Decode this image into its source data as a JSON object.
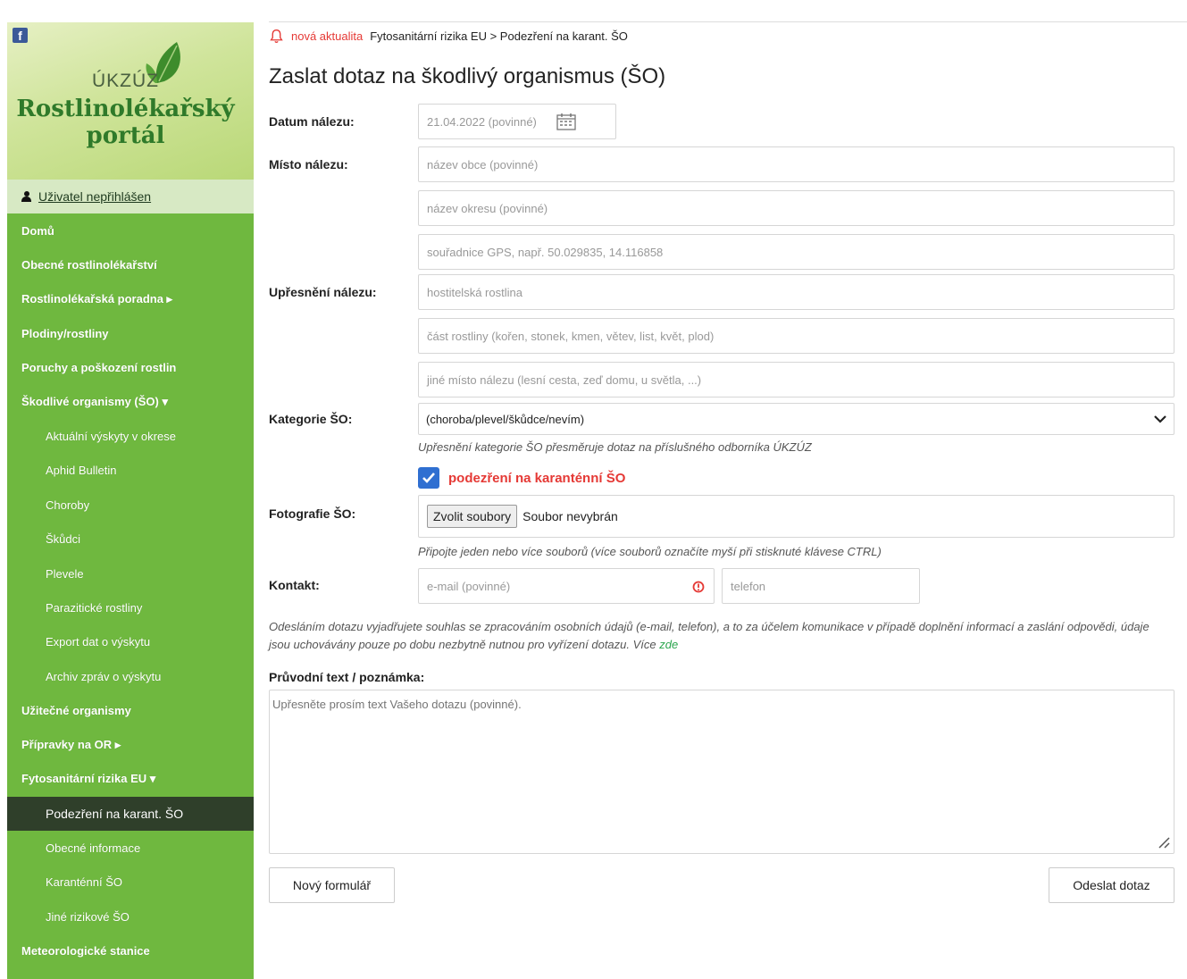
{
  "sidebar": {
    "brand_short": "ÚKZÚZ",
    "brand_title": "Rostlinolékařský portál",
    "user": "Uživatel nepřihlášen",
    "nav": [
      {
        "label": "Domů",
        "level": 1
      },
      {
        "label": "Obecné rostlinolékařství",
        "level": 1
      },
      {
        "label": "Rostlinolékařská poradna ▸",
        "level": 1
      },
      {
        "label": "Plodiny/rostliny",
        "level": 1
      },
      {
        "label": "Poruchy a poškození rostlin",
        "level": 1
      },
      {
        "label": "Škodlivé organismy (ŠO) ▾",
        "level": 1
      },
      {
        "label": "Aktuální výskyty v okrese",
        "level": 2
      },
      {
        "label": "Aphid Bulletin",
        "level": 2
      },
      {
        "label": "Choroby",
        "level": 2
      },
      {
        "label": "Škůdci",
        "level": 2
      },
      {
        "label": "Plevele",
        "level": 2
      },
      {
        "label": "Parazitické rostliny",
        "level": 2
      },
      {
        "label": "Export dat o výskytu",
        "level": 2
      },
      {
        "label": "Archiv zpráv o výskytu",
        "level": 2
      },
      {
        "label": "Užitečné organismy",
        "level": 1
      },
      {
        "label": "Přípravky na OR ▸",
        "level": 1
      },
      {
        "label": "Fytosanitární rizika EU ▾",
        "level": 1
      },
      {
        "label": "Podezření na karant. ŠO",
        "level": 2,
        "active": true
      },
      {
        "label": "Obecné informace",
        "level": 2
      },
      {
        "label": "Karanténní ŠO",
        "level": 2
      },
      {
        "label": "Jiné rizikové ŠO",
        "level": 2
      },
      {
        "label": "Meteorologické stanice",
        "level": 1
      }
    ]
  },
  "breadcrumb": {
    "new_news": "nová aktualita",
    "path": "Fytosanitární rizika EU > Podezření na karant. ŠO"
  },
  "page_title": "Zaslat dotaz na škodlivý organismus (ŠO)",
  "form": {
    "date_label": "Datum nálezu:",
    "date_value": "21.04.2022 (povinné)",
    "place_label": "Místo nálezu:",
    "place_placeholders": [
      "název obce (povinné)",
      "název okresu (povinné)",
      "souřadnice GPS, např. 50.029835, 14.116858"
    ],
    "detail_label": "Upřesnění nálezu:",
    "detail_placeholders": [
      "hostitelská rostlina",
      "část rostliny (kořen, stonek, kmen, větev, list, květ, plod)",
      "jiné místo nálezu (lesní cesta, zeď domu, u světla, ...)"
    ],
    "category_label": "Kategorie ŠO:",
    "category_value": "(choroba/plevel/škůdce/nevím)",
    "category_hint": "Upřesnění kategorie ŠO přesměruje dotaz na příslušného odborníka ÚKZÚZ",
    "quarantine_checked": true,
    "quarantine_label": "podezření na karanténní ŠO",
    "photo_label": "Fotografie ŠO:",
    "file_button": "Zvolit soubory",
    "file_status": "Soubor nevybrán",
    "photo_hint": "Připojte jeden nebo více souborů (více souborů označíte myší při stisknuté klávese CTRL)",
    "contact_label": "Kontakt:",
    "email_placeholder": "e-mail (povinné)",
    "phone_placeholder": "telefon",
    "consent_text": "Odesláním dotazu vyjadřujete souhlas se zpracováním osobních údajů (e-mail, telefon), a to za účelem komunikace v případě doplnění informací a zaslání odpovědi, údaje jsou uchovávány pouze po dobu nezbytně nutnou pro vyřízení dotazu. Více ",
    "consent_link": "zde",
    "note_label": "Průvodní text / poznámka:",
    "note_placeholder": "Upřesněte prosím text Vašeho dotazu (povinné).",
    "new_form_button": "Nový formulář",
    "submit_button": "Odeslat dotaz"
  },
  "colors": {
    "sidebar_green": "#6fb83f",
    "active_item": "#2f3f2a",
    "alert_red": "#e53935",
    "checkbox_blue": "#2f6fd1",
    "link_green": "#2aa54d"
  }
}
